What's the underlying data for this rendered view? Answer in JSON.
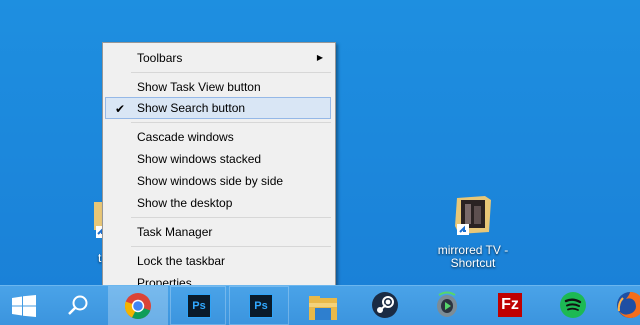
{
  "desktop": {
    "left_icon_label": "t",
    "shortcut": {
      "label_line1": "mirrored TV -",
      "label_line2": "Shortcut"
    }
  },
  "context_menu": {
    "items": [
      {
        "label": "Toolbars",
        "has_submenu": true
      },
      {
        "label": "Show Task View button"
      },
      {
        "label": "Show Search button",
        "checked": true
      },
      {
        "label": "Cascade windows"
      },
      {
        "label": "Show windows stacked"
      },
      {
        "label": "Show windows side by side"
      },
      {
        "label": "Show the desktop"
      },
      {
        "label": "Task Manager"
      },
      {
        "label": "Lock the taskbar"
      },
      {
        "label": "Properties"
      }
    ],
    "check_glyph": "✔",
    "submenu_glyph": "▶"
  },
  "taskbar": {
    "items": [
      {
        "name": "start-button",
        "icon": "windows-logo-icon"
      },
      {
        "name": "search-button",
        "icon": "search-icon"
      },
      {
        "name": "chrome",
        "icon": "chrome-icon"
      },
      {
        "name": "photoshop-1",
        "icon": "photoshop-icon",
        "text": "Ps"
      },
      {
        "name": "photoshop-2",
        "icon": "photoshop-icon",
        "text": "Ps"
      },
      {
        "name": "file-explorer",
        "icon": "folder-icon"
      },
      {
        "name": "steam",
        "icon": "steam-icon"
      },
      {
        "name": "media-player",
        "icon": "media-player-icon"
      },
      {
        "name": "filezilla",
        "icon": "filezilla-icon",
        "text": "Fz"
      },
      {
        "name": "spotify",
        "icon": "spotify-icon"
      },
      {
        "name": "firefox",
        "icon": "firefox-icon"
      }
    ]
  },
  "colors": {
    "desktop": "#1c88dc",
    "taskbar": "#3e97df",
    "menu_bg": "#f0f0f0",
    "menu_highlight": "#d9e6f5",
    "photoshop_blue": "#31a8ff",
    "filezilla_red": "#bf0000",
    "spotify_green": "#1db954"
  }
}
